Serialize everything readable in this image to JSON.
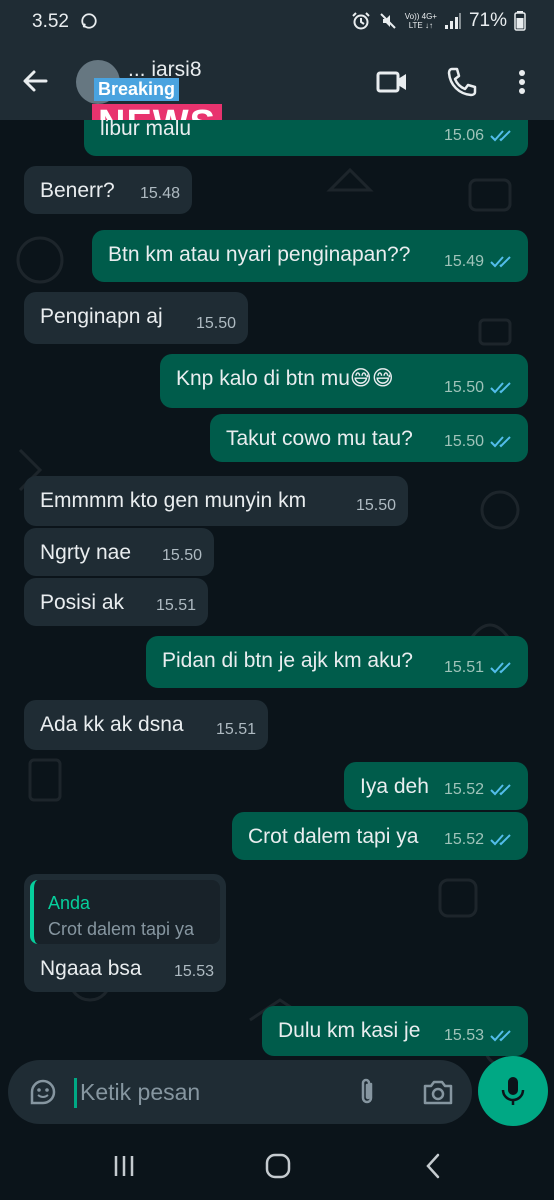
{
  "status_bar": {
    "time": "3.52",
    "network_top": "Vo)) 4G+",
    "network_bottom": "LTE ↓↑",
    "battery": "71%"
  },
  "app_bar": {
    "contact_name": "... iarsi8",
    "overlay_top": "Breaking",
    "overlay_main": "NEWS"
  },
  "messages": [
    {
      "dir": "out",
      "text": "libur malu",
      "time": "15.06",
      "ticks": "read"
    },
    {
      "dir": "in",
      "text": "Benerr?",
      "time": "15.48"
    },
    {
      "dir": "out",
      "text": "Btn km atau nyari penginapan??",
      "time": "15.49",
      "ticks": "read"
    },
    {
      "dir": "in",
      "text": "Penginapn aj",
      "time": "15.50"
    },
    {
      "dir": "out",
      "text": "Knp kalo di btn mu😅😅",
      "time": "15.50",
      "ticks": "read"
    },
    {
      "dir": "out",
      "text": "Takut cowo mu tau?",
      "time": "15.50",
      "ticks": "read"
    },
    {
      "dir": "in",
      "text": "Emmmm kto gen munyin km",
      "time": "15.50"
    },
    {
      "dir": "in",
      "text": "Ngrty nae",
      "time": "15.50"
    },
    {
      "dir": "in",
      "text": "Posisi ak",
      "time": "15.51"
    },
    {
      "dir": "out",
      "text": "Pidan di btn je ajk km aku?",
      "time": "15.51",
      "ticks": "read"
    },
    {
      "dir": "in",
      "text": "Ada kk ak dsna",
      "time": "15.51"
    },
    {
      "dir": "out",
      "text": "Iya deh",
      "time": "15.52",
      "ticks": "read"
    },
    {
      "dir": "out",
      "text": "Crot dalem tapi ya",
      "time": "15.52",
      "ticks": "read"
    },
    {
      "dir": "in",
      "text": "Ngaaa bsa",
      "time": "15.53",
      "quote": {
        "name": "Anda",
        "text": "Crot dalem tapi ya"
      }
    },
    {
      "dir": "out",
      "text": "Dulu km kasi je",
      "time": "15.53",
      "ticks": "read"
    }
  ],
  "composer": {
    "placeholder": "Ketik pesan"
  },
  "icons": {
    "back": "arrow-left-icon",
    "video": "video-call-icon",
    "call": "phone-icon",
    "menu": "more-vertical-icon",
    "emoji": "sticker-icon",
    "attach": "paperclip-icon",
    "camera": "camera-icon",
    "mic": "microphone-icon"
  },
  "colors": {
    "background": "#0b141a",
    "header": "#1f2c34",
    "incoming_bubble": "#1f2c34",
    "outgoing_bubble": "#005c4b",
    "accent": "#00a884",
    "read_ticks": "#53bdeb"
  }
}
